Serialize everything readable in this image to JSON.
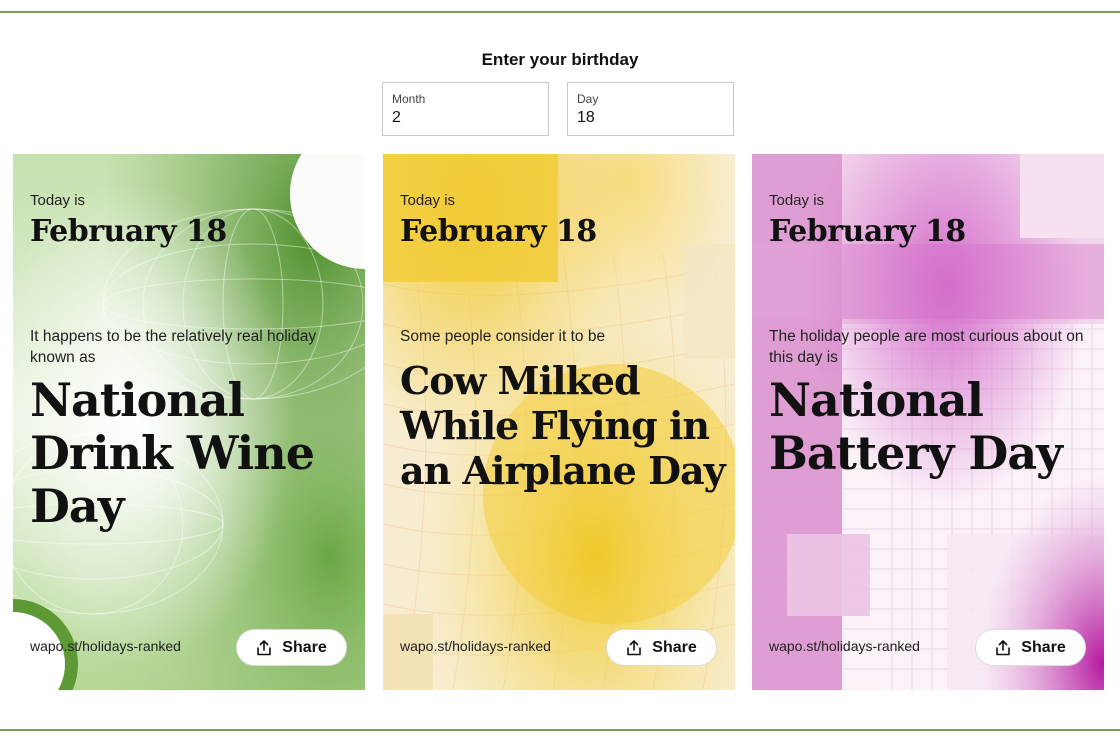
{
  "form": {
    "heading": "Enter your birthday",
    "month": {
      "label": "Month",
      "value": "2"
    },
    "day": {
      "label": "Day",
      "value": "18"
    }
  },
  "cards": [
    {
      "theme_color": "#6ea84a",
      "today_label": "Today is",
      "date": "February 18",
      "intro": "It happens to be the relatively real holiday known as",
      "holiday": "National Drink Wine Day",
      "link": "wapo.st/holidays-ranked",
      "share_label": "Share",
      "share_icon": "share-icon"
    },
    {
      "theme_color": "#f2cf3c",
      "today_label": "Today is",
      "date": "February 18",
      "intro": "Some people consider it to be",
      "holiday": "Cow Milked While Flying in an Airplane Day",
      "link": "wapo.st/holidays-ranked",
      "share_label": "Share",
      "share_icon": "share-icon"
    },
    {
      "theme_color": "#b92db0",
      "today_label": "Today is",
      "date": "February 18",
      "intro": "The holiday people are most curious about on this day is",
      "holiday": "National Battery Day",
      "link": "wapo.st/holidays-ranked",
      "share_label": "Share",
      "share_icon": "share-icon"
    }
  ],
  "colors": {
    "rule": "#7d9a5f"
  }
}
